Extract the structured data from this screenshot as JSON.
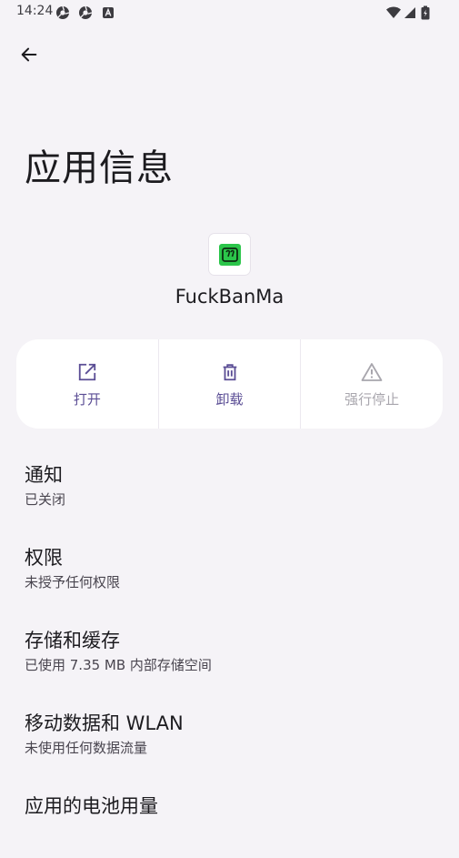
{
  "status_bar": {
    "time": "14:24",
    "left_icons": [
      "chrome-icon",
      "chrome-icon",
      "accessibility-a-icon"
    ],
    "right_icons": [
      "wifi-icon",
      "signal-icon",
      "battery-icon"
    ]
  },
  "header": {
    "back_icon": "arrow-left-icon",
    "title": "应用信息"
  },
  "app": {
    "name": "FuckBanMa",
    "icon_color": "#2BC54A"
  },
  "actions": [
    {
      "label": "打开",
      "icon": "open-external-icon",
      "enabled": true
    },
    {
      "label": "卸载",
      "icon": "trash-icon",
      "enabled": true
    },
    {
      "label": "强行停止",
      "icon": "warning-icon",
      "enabled": false
    }
  ],
  "preferences": [
    {
      "title": "通知",
      "summary": "已关闭"
    },
    {
      "title": "权限",
      "summary": "未授予任何权限"
    },
    {
      "title": "存储和缓存",
      "summary": "已使用 7.35 MB 内部存储空间"
    },
    {
      "title": "移动数据和 WLAN",
      "summary": "未使用任何数据流量"
    },
    {
      "title": "应用的电池用量",
      "summary": ""
    }
  ],
  "colors": {
    "background": "#F5F3F7",
    "accent": "#5B4E95",
    "disabled": "#A8A6AD"
  }
}
